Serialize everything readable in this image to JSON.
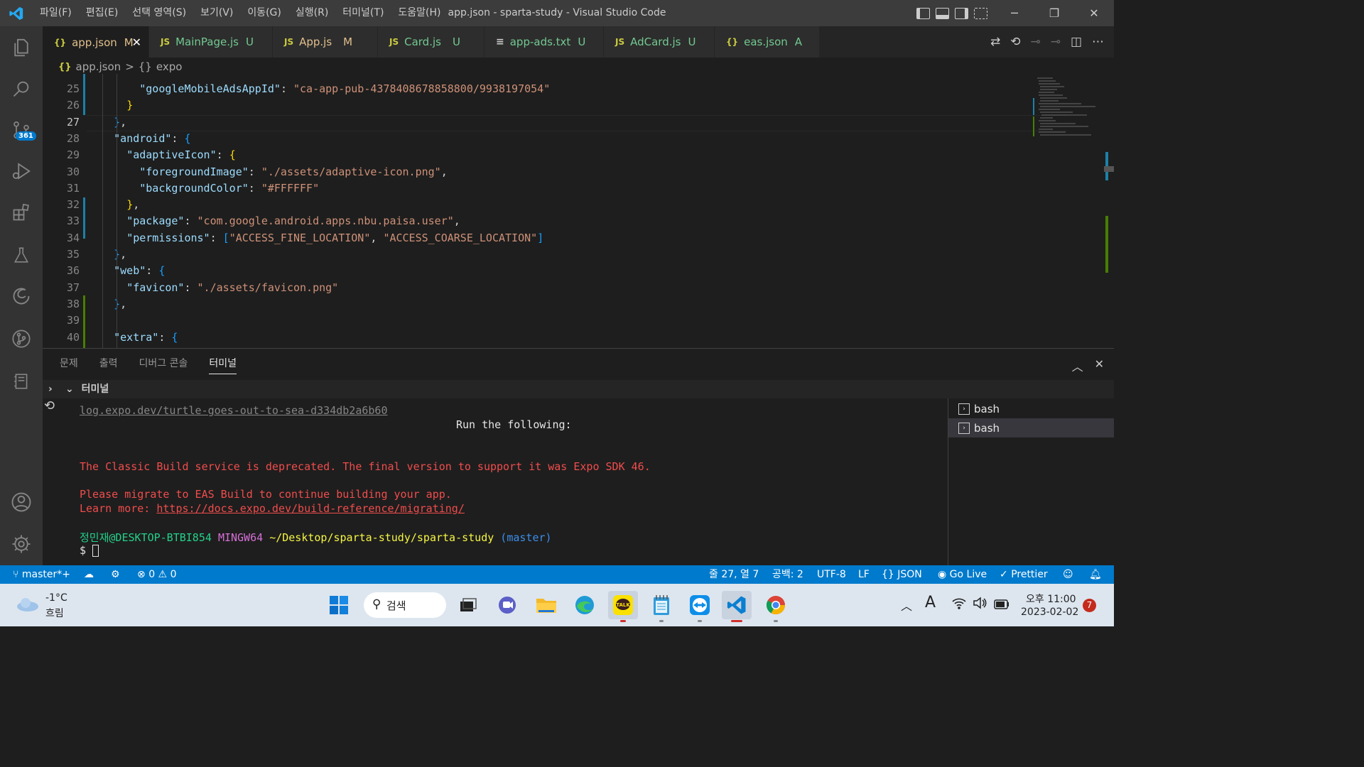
{
  "titlebar": {
    "menu": [
      "파일(F)",
      "편집(E)",
      "선택 영역(S)",
      "보기(V)",
      "이동(G)",
      "실행(R)",
      "터미널(T)",
      "도움말(H)"
    ],
    "title": "app.json - sparta-study - Visual Studio Code"
  },
  "activity": {
    "scm_badge": "361"
  },
  "tabs": [
    {
      "icon": "{}",
      "label": "app.json",
      "status": "M",
      "active": true
    },
    {
      "icon": "JS",
      "label": "MainPage.js",
      "status": "U"
    },
    {
      "icon": "JS",
      "label": "App.js",
      "status": "M"
    },
    {
      "icon": "JS",
      "label": "Card.js",
      "status": "U"
    },
    {
      "icon": "≡",
      "label": "app-ads.txt",
      "status": "U"
    },
    {
      "icon": "JS",
      "label": "AdCard.js",
      "status": "U"
    },
    {
      "icon": "{}",
      "label": "eas.json",
      "status": "A"
    }
  ],
  "breadcrumb": {
    "file_icon": "{}",
    "file": "app.json",
    "sep": ">",
    "symbol_icon": "{}",
    "symbol": "expo"
  },
  "code": {
    "current_line": 27,
    "lines": [
      {
        "n": "25",
        "text": "        \"googleMobileAdsAppId\": \"ca-app-pub-4378408678858800/9938197054\""
      },
      {
        "n": "26",
        "text": "      }"
      },
      {
        "n": "27",
        "text": "    },"
      },
      {
        "n": "28",
        "text": "    \"android\": {"
      },
      {
        "n": "29",
        "text": "      \"adaptiveIcon\": {"
      },
      {
        "n": "30",
        "text": "        \"foregroundImage\": \"./assets/adaptive-icon.png\","
      },
      {
        "n": "31",
        "text": "        \"backgroundColor\": \"#FFFFFF\""
      },
      {
        "n": "32",
        "text": "      },"
      },
      {
        "n": "33",
        "text": "      \"package\": \"com.google.android.apps.nbu.paisa.user\","
      },
      {
        "n": "34",
        "text": "      \"permissions\": [\"ACCESS_FINE_LOCATION\", \"ACCESS_COARSE_LOCATION\"]"
      },
      {
        "n": "35",
        "text": "    },"
      },
      {
        "n": "36",
        "text": "    \"web\": {"
      },
      {
        "n": "37",
        "text": "      \"favicon\": \"./assets/favicon.png\""
      },
      {
        "n": "38",
        "text": "    },"
      },
      {
        "n": "39",
        "text": ""
      },
      {
        "n": "40",
        "text": "    \"extra\": {"
      }
    ]
  },
  "panel": {
    "tabs": [
      "문제",
      "출력",
      "디버그 콘솔",
      "터미널"
    ],
    "active_tab": "터미널",
    "section": "터미널",
    "terminal": {
      "log_link": "log.expo.dev/turtle-goes-out-to-sea-d334db2a6b60",
      "run_following": "Run the following:",
      "deprecated": "The Classic Build service is deprecated. The final version to support it was Expo SDK 46.",
      "migrate": "Please migrate to EAS Build to continue building your app.",
      "learn_prefix": "Learn more: ",
      "learn_link": "https://docs.expo.dev/build-reference/migrating/",
      "prompt_user": "정민재@DESKTOP-BTBI854",
      "prompt_env": "MINGW64",
      "prompt_path": "~/Desktop/sparta-study/sparta-study",
      "prompt_branch": "(master)",
      "prompt_symbol": "$"
    },
    "terminal_list": [
      "bash",
      "bash"
    ]
  },
  "status": {
    "branch": "master*+",
    "errors": "0",
    "warnings": "0",
    "position": "줄 27, 열 7",
    "spaces": "공백: 2",
    "encoding": "UTF-8",
    "eol": "LF",
    "language": "JSON",
    "golive": "Go Live",
    "prettier": "Prettier"
  },
  "taskbar": {
    "weather_temp": "-1°C",
    "weather_desc": "흐림",
    "search_label": "검색",
    "ime": "A",
    "time": "오후 11:00",
    "date": "2023-02-02",
    "notif_count": "7"
  },
  "colors": {
    "accent": "#007acc",
    "titlebar": "#3c3c3c",
    "editor_bg": "#1e1e1e",
    "error_red": "#f14c4c"
  }
}
